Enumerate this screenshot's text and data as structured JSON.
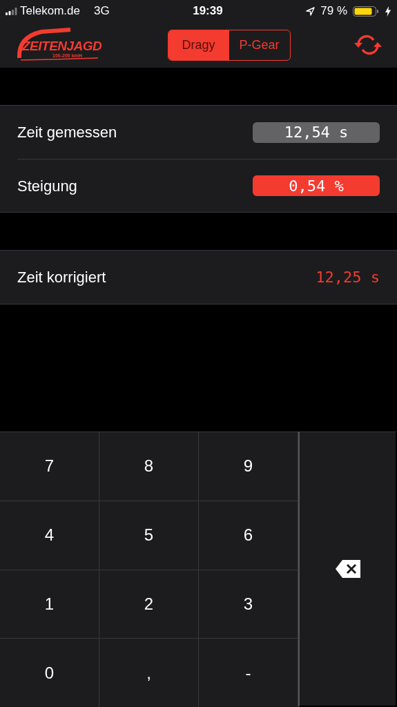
{
  "status_bar": {
    "carrier": "Telekom.de",
    "network": "3G",
    "time": "19:39",
    "battery": "79 %"
  },
  "header": {
    "logo": {
      "title": "ZEITENJAGD",
      "subtitle": "100-200 kmH"
    },
    "segments": [
      {
        "label": "Dragy",
        "selected": true
      },
      {
        "label": "P-Gear",
        "selected": false
      }
    ]
  },
  "groups": [
    {
      "rows": [
        {
          "label": "Zeit gemessen",
          "value": "12,54 s",
          "kind": "field",
          "highlighted": false
        },
        {
          "label": "Steigung",
          "value": "0,54 %",
          "kind": "field",
          "highlighted": true
        }
      ]
    },
    {
      "rows": [
        {
          "label": "Zeit korrigiert",
          "value": "12,25 s",
          "kind": "text",
          "highlighted": false
        }
      ]
    }
  ],
  "keypad": {
    "keys": [
      "7",
      "8",
      "9",
      "4",
      "5",
      "6",
      "1",
      "2",
      "3",
      "0",
      ",",
      "-"
    ]
  }
}
